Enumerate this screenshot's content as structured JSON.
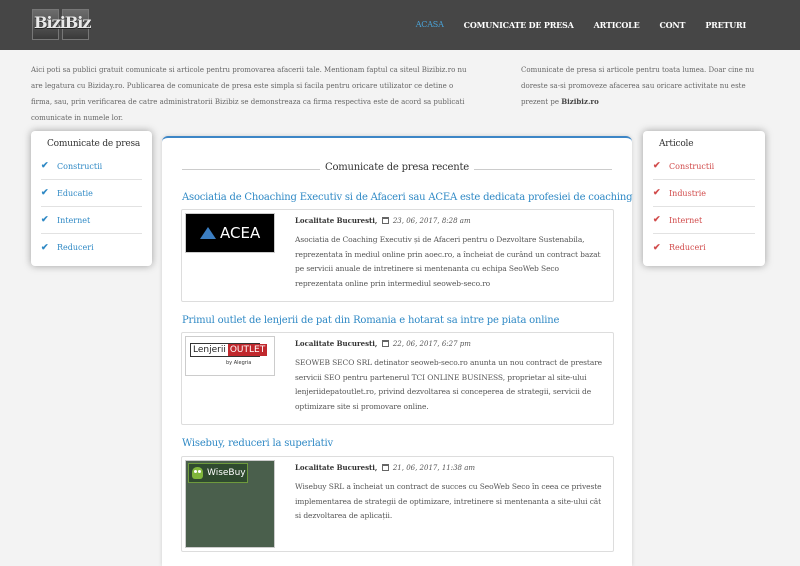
{
  "header": {
    "logo_text": "BiziBiz",
    "nav": [
      {
        "label": "ACASA",
        "active": true
      },
      {
        "label": "COMUNICATE DE PRESA",
        "active": false
      },
      {
        "label": "ARTICOLE",
        "active": false
      },
      {
        "label": "CONT",
        "active": false
      },
      {
        "label": "PRETURI",
        "active": false
      }
    ]
  },
  "intro": {
    "left": "Aici poti sa publici gratuit comunicate si articole pentru promovarea afacerii tale. Mentionam faptul ca siteul Bizibiz.ro nu are legatura cu Biziday.ro. Publicarea de comunicate de presa este simpla si facila pentru oricare utilizator ce detine o firma, sau, prin verificarea de catre administratorii Bizibiz se demonstreaza ca firma respectiva este de acord sa publicati comunicate in numele lor.",
    "right_text": "Comunicate de presa si articole pentru toata lumea. Doar cine nu doreste sa-si promoveze afacerea sau oricare activitate nu este prezent pe ",
    "right_bold": "Bizibiz.ro"
  },
  "sidebar_left": {
    "title": "Comunicate de presa",
    "items": [
      "Constructii",
      "Educatie",
      "Internet",
      "Reduceri"
    ]
  },
  "sidebar_right": {
    "title": "Articole",
    "items": [
      "Constructii",
      "Industrie",
      "Internet",
      "Reduceri"
    ]
  },
  "main": {
    "title": "Comunicate de presa recente",
    "articles": [
      {
        "title": "Asociatia de Choaching Executiv si de Afaceri sau ACEA este dedicata profesiei de coaching",
        "location_label": "Localitate Bucuresti,",
        "date": "23, 06, 2017, 8:28 am",
        "excerpt": "Asociatia de Coaching Executiv și de Afaceri pentru o Dezvoltare Sustenabila, reprezentata în mediul online prin aoec.ro, a încheiat de curând un contract bazat pe servicii anuale de intretinere si mentenanta cu echipa SeoWeb Seco reprezentata online prin intermediul seoweb-seco.ro",
        "thumb_text": "ACEA"
      },
      {
        "title": "Primul outlet de lenjerii de pat din Romania e hotarat sa intre pe piata online",
        "location_label": "Localitate Bucuresti,",
        "date": "22, 06, 2017, 6:27 pm",
        "excerpt": "SEOWEB SECO SRL detinator seoweb-seco.ro anunta un nou contract de prestare servicii SEO pentru partenerul TCI ONLINE BUSINESS, proprietar al site-ului lenjeriidepatoutlet.ro, privind dezvoltarea si conceperea de strategii, servicii de optimizare site si promovare online.",
        "thumb_text_a": "Lenjerii",
        "thumb_text_b": "OUTLET",
        "thumb_sub": "by Alegria"
      },
      {
        "title": "Wisebuy, reduceri la superlativ",
        "location_label": "Localitate Bucuresti,",
        "date": "21, 06, 2017, 11:38 am",
        "excerpt": "Wisebuy SRL a încheiat un contract de succes cu SeoWeb Seco în ceea ce priveste implementarea de strategii de optimizare, intretinere si mentenanta a site-ului cât si dezvoltarea de aplicații.",
        "thumb_text": "WiseBuy"
      }
    ]
  },
  "colors": {
    "header_bg": "#464646",
    "nav_active": "#4aa3d8",
    "link_blue": "#2f89c5",
    "link_red": "#d14b4b"
  }
}
